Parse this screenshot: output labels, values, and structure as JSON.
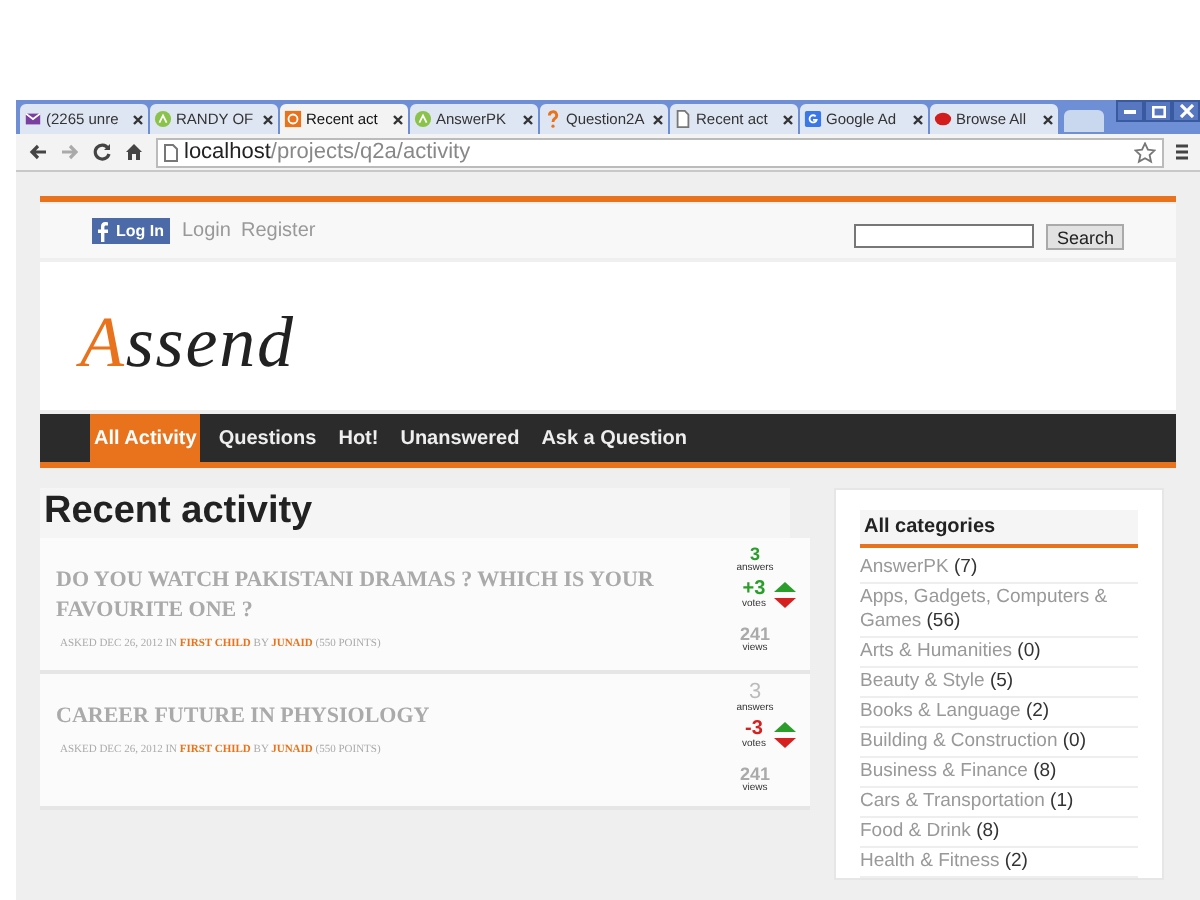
{
  "browser": {
    "tabs": [
      {
        "label": "(2265 unre",
        "kind": "mail",
        "selected": false
      },
      {
        "label": "RANDY OF",
        "kind": "android",
        "selected": false
      },
      {
        "label": "Recent act",
        "kind": "q2a",
        "selected": true
      },
      {
        "label": "AnswerPK",
        "kind": "android",
        "selected": false
      },
      {
        "label": "Question2A",
        "kind": "question",
        "selected": false
      },
      {
        "label": "Recent act",
        "kind": "page",
        "selected": false
      },
      {
        "label": "Google Ad",
        "kind": "google",
        "selected": false
      },
      {
        "label": "Browse All",
        "kind": "red",
        "selected": false
      }
    ],
    "url_host": "localhost",
    "url_path": "/projects/q2a/activity"
  },
  "header": {
    "facebook_button": "Log In",
    "links": [
      "Login",
      "Register"
    ],
    "search_button": "Search"
  },
  "logo": {
    "initial": "A",
    "rest": "ssend"
  },
  "nav": [
    {
      "label": "All Activity",
      "selected": true
    },
    {
      "label": "Questions",
      "selected": false
    },
    {
      "label": "Hot!",
      "selected": false
    },
    {
      "label": "Unanswered",
      "selected": false
    },
    {
      "label": "Ask a Question",
      "selected": false
    }
  ],
  "main": {
    "heading": "Recent activity",
    "questions": [
      {
        "title": "DO YOU WATCH PAKISTANI DRAMAS ? WHICH IS YOUR FAVOURITE ONE ?",
        "meta_prefix": "ASKED DEC 26, 2012 IN",
        "category": "FIRST CHILD",
        "meta_by": "BY",
        "user": "JUNAID",
        "points": "(550 POINTS)",
        "answers": "3",
        "answers_label": "answers",
        "answer_selected": true,
        "votes": {
          "value": "+3",
          "color": "#2a9d2a"
        },
        "votes_label": "votes",
        "views": "241",
        "views_label": "views"
      },
      {
        "title": "CAREER FUTURE IN PHYSIOLOGY",
        "meta_prefix": "ASKED DEC 26, 2012 IN",
        "category": "FIRST CHILD",
        "meta_by": "BY",
        "user": "JUNAID",
        "points": "(550 POINTS)",
        "answers": "3",
        "answers_label": "answers",
        "answer_selected": false,
        "votes": {
          "value": "-3",
          "color": "#d62020"
        },
        "votes_label": "votes",
        "views": "241",
        "views_label": "views"
      }
    ]
  },
  "sidebar": {
    "title": "All categories",
    "categories": [
      {
        "name": "AnswerPK",
        "count": "(7)"
      },
      {
        "name": "Apps, Gadgets, Computers & Games",
        "count": "(56)"
      },
      {
        "name": "Arts & Humanities",
        "count": "(0)"
      },
      {
        "name": "Beauty & Style",
        "count": "(5)"
      },
      {
        "name": "Books & Language",
        "count": "(2)"
      },
      {
        "name": "Building & Construction",
        "count": "(0)"
      },
      {
        "name": "Business & Finance",
        "count": "(8)"
      },
      {
        "name": "Cars & Transportation",
        "count": "(1)"
      },
      {
        "name": "Food & Drink",
        "count": "(8)"
      },
      {
        "name": "Health & Fitness",
        "count": "(2)"
      }
    ]
  }
}
